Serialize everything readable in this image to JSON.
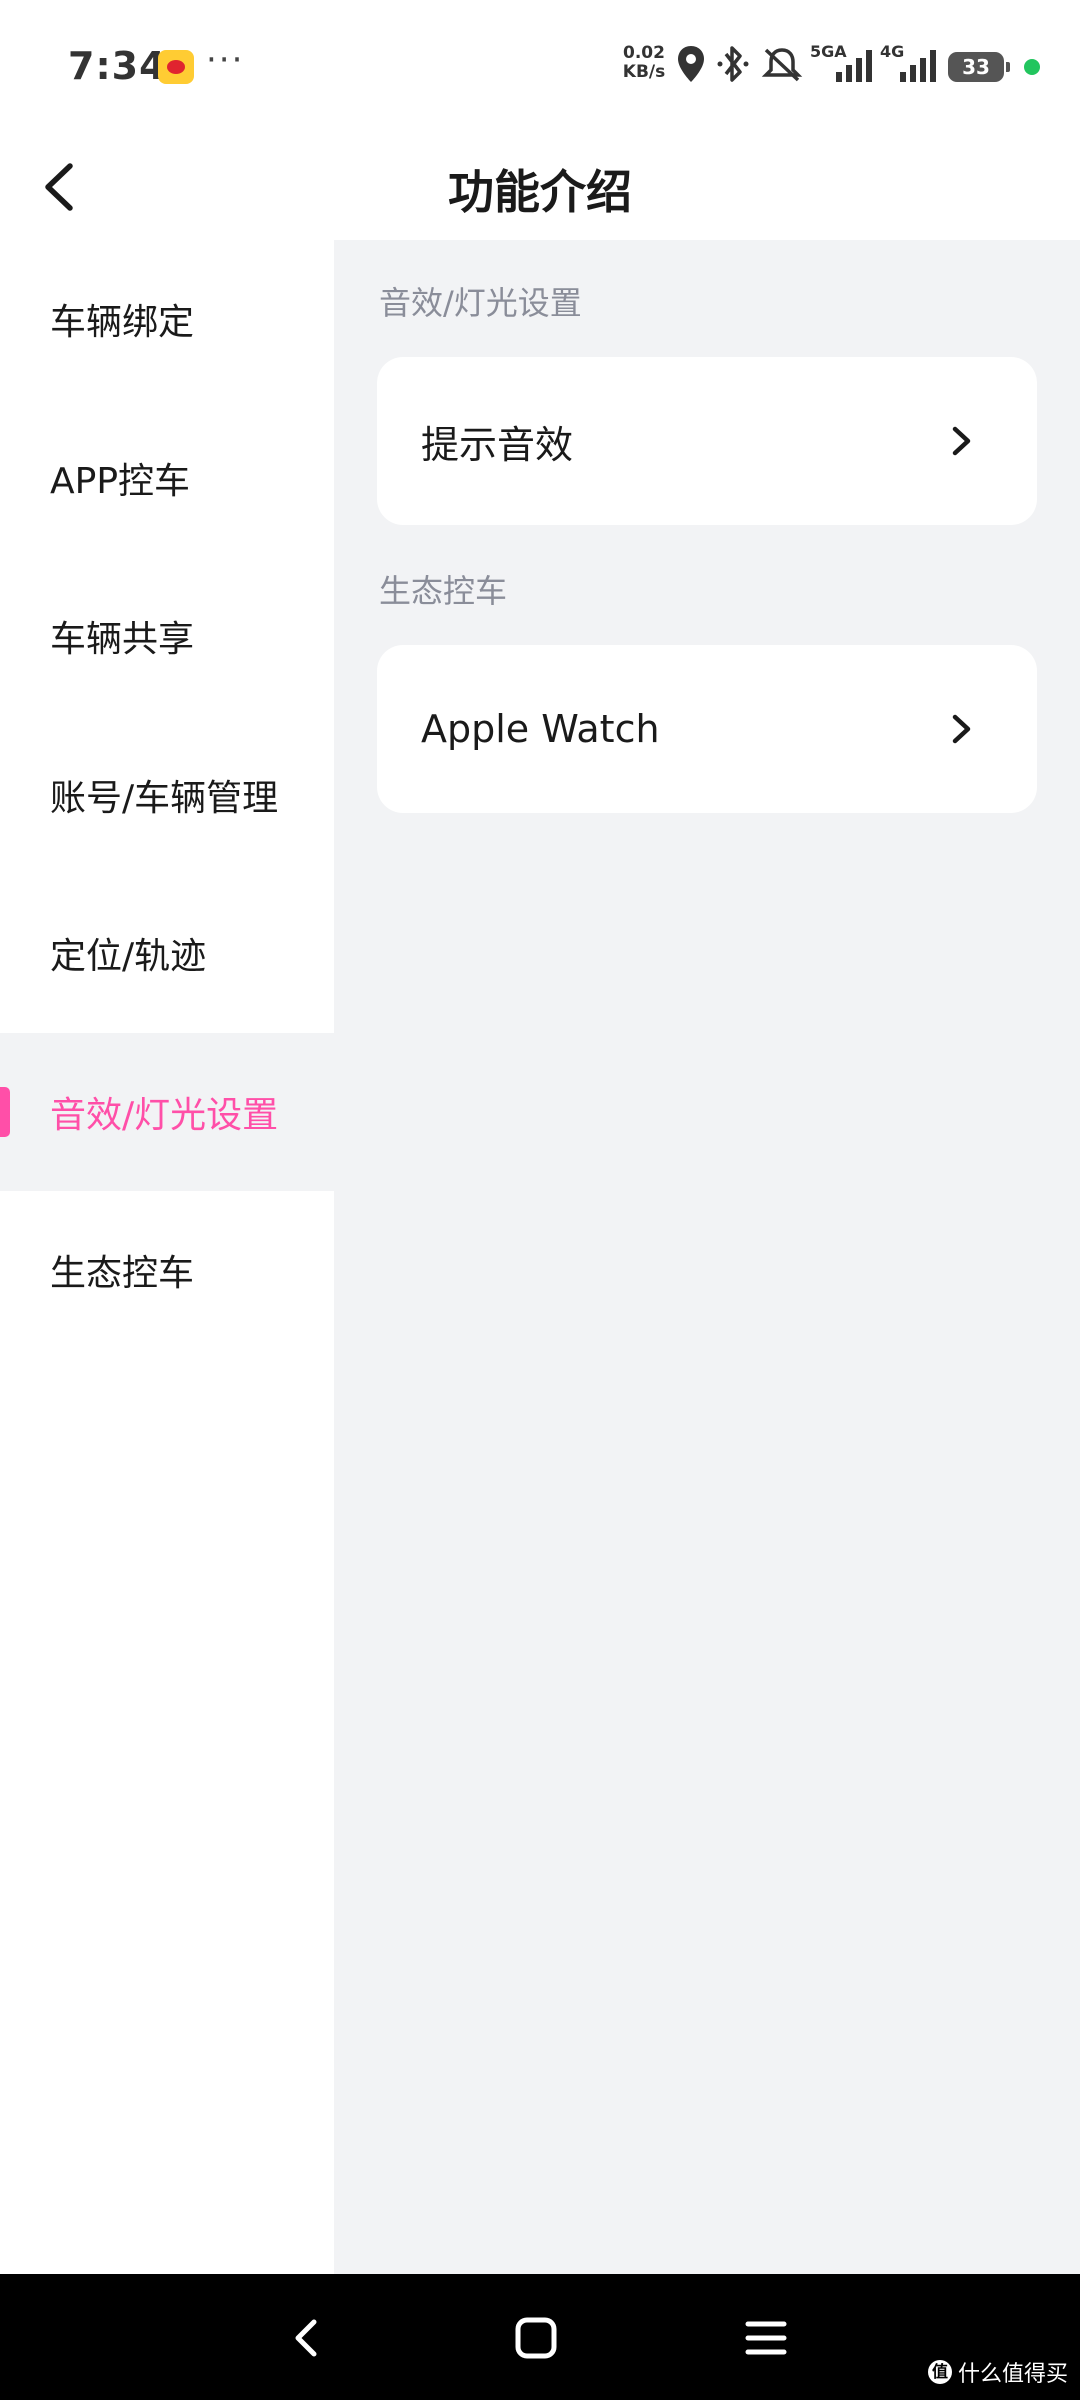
{
  "status_bar": {
    "time": "7:34",
    "dots": "···",
    "net_rate_value": "0.02",
    "net_rate_unit": "KB/s",
    "signal_5g_label": "5GA",
    "signal_4g_label": "4G",
    "battery": "33",
    "dot_color": "#22c55e"
  },
  "header": {
    "title": "功能介绍"
  },
  "sidebar": {
    "accent_color": "#ff4fa8",
    "items": [
      {
        "label": "车辆绑定"
      },
      {
        "label": "APP控车"
      },
      {
        "label": "车辆共享"
      },
      {
        "label": "账号/车辆管理"
      },
      {
        "label": "定位/轨迹"
      },
      {
        "label": "音效/灯光设置",
        "active": true
      },
      {
        "label": "生态控车"
      }
    ]
  },
  "main": {
    "sections": [
      {
        "title": "音效/灯光设置",
        "items": [
          {
            "label": "提示音效"
          }
        ]
      },
      {
        "title": "生态控车",
        "items": [
          {
            "label": "Apple Watch"
          }
        ]
      }
    ]
  },
  "nav_bar": {
    "watermark": "什么值得买",
    "watermark_logo": "值"
  }
}
